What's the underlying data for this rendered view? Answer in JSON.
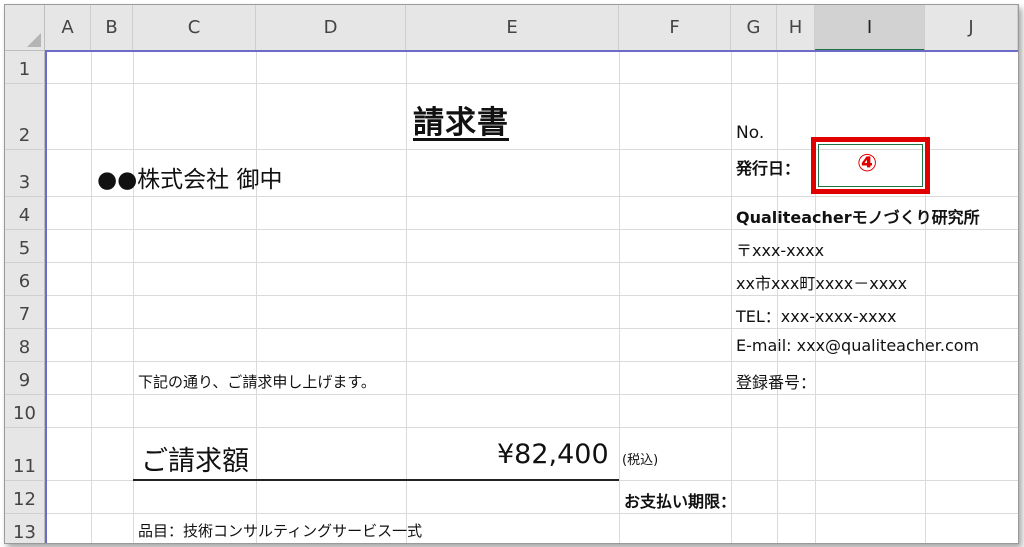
{
  "columns": [
    "A",
    "B",
    "C",
    "D",
    "E",
    "F",
    "G",
    "H",
    "I",
    "J"
  ],
  "selected_column": "I",
  "rows": [
    "1",
    "2",
    "3",
    "4",
    "5",
    "6",
    "7",
    "8",
    "9",
    "10",
    "11",
    "12",
    "13"
  ],
  "invoice": {
    "title": "請求書",
    "recipient": "●●株式会社 御中",
    "no_label": "No.",
    "issue_date_label": "発行日：",
    "issue_date_marker": "④",
    "company_name": "Qualiteacherモノづくり研究所",
    "postal": "〒xxx-xxxx",
    "address": "xx市xxx町xxxx－xxxx",
    "tel": "TEL：xxx-xxxx-xxxx",
    "email": "E-mail: xxx@qualiteacher.com",
    "registration_label": "登録番号：",
    "intro": "下記の通り、ご請求申し上げます。",
    "amount_label": "ご請求額",
    "amount_value": "¥82,400",
    "tax_note": "(税込)",
    "due_label": "お支払い期限：",
    "item_line": "品目：技術コンサルティングサービス一式"
  },
  "colors": {
    "highlight_box": "#e00000",
    "selected_header_accent": "#217346"
  }
}
